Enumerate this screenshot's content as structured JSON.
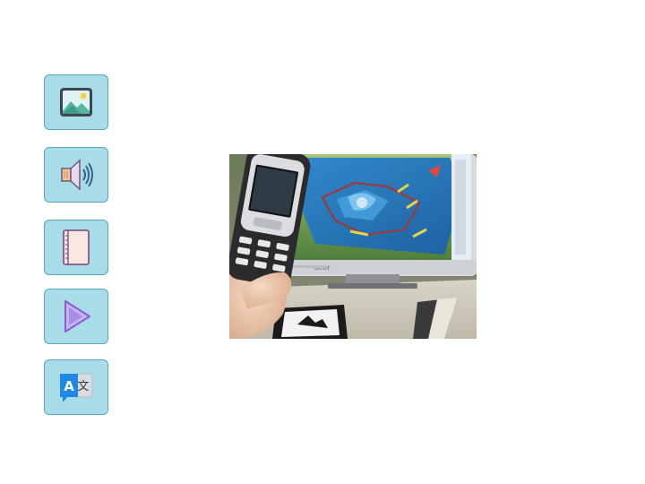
{
  "toolbar": {
    "buttons": [
      {
        "id": "image",
        "icon": "image-icon"
      },
      {
        "id": "audio",
        "icon": "speaker-icon"
      },
      {
        "id": "book",
        "icon": "book-icon"
      },
      {
        "id": "play",
        "icon": "play-icon"
      },
      {
        "id": "translate",
        "icon": "translate-icon"
      }
    ]
  },
  "photo": {
    "subject": "augmented-reality-phone-photo",
    "monitor_brand": "acer"
  },
  "colors": {
    "button_bg": "#a9dce9",
    "button_border": "#5aa7bd",
    "translate_blue": "#1e88e5"
  }
}
